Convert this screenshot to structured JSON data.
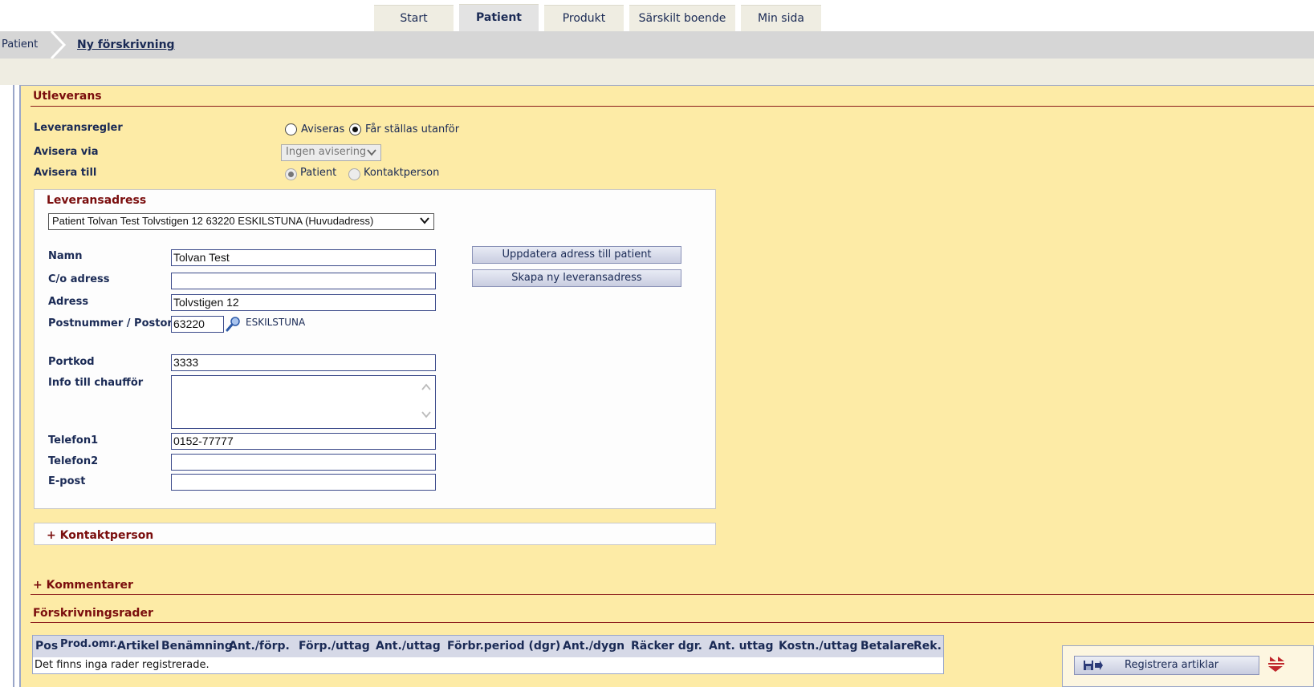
{
  "tabs": [
    {
      "label": "Start",
      "active": false
    },
    {
      "label": "Patient",
      "active": true
    },
    {
      "label": "Produkt",
      "active": false
    },
    {
      "label": "Särskilt boende",
      "active": false
    },
    {
      "label": "Min sida",
      "active": false
    }
  ],
  "breadcrumb": {
    "first": "Patient",
    "current": "Ny förskrivning"
  },
  "utleverans": {
    "title": "Utleverans",
    "leveransregler_label": "Leveransregler",
    "leveransregler_options": [
      "Aviseras",
      "Får ställas utanför"
    ],
    "leveransregler_selected": "Får ställas utanför",
    "avisera_via_label": "Avisera via",
    "avisera_via_value": "Ingen avisering",
    "avisera_till_label": "Avisera till",
    "avisera_till_options": [
      "Patient",
      "Kontaktperson"
    ],
    "avisera_till_selected": "Patient"
  },
  "leveransadress": {
    "title": "Leveransadress",
    "selected_address": "Patient Tolvan Test Tolvstigen 12 63220 ESKILSTUNA (Huvudadress)",
    "fields": {
      "namn_label": "Namn",
      "namn_value": "Tolvan Test",
      "co_label": "C/o adress",
      "co_value": "",
      "adress_label": "Adress",
      "adress_value": "Tolvstigen 12",
      "postnr_label": "Postnummer / Postort",
      "postnr_value": "63220",
      "postort": "ESKILSTUNA",
      "portkod_label": "Portkod",
      "portkod_value": "3333",
      "info_label": "Info till chaufför",
      "info_value": "",
      "tel1_label": "Telefon1",
      "tel1_value": "0152-77777",
      "tel2_label": "Telefon2",
      "tel2_value": "",
      "epost_label": "E-post",
      "epost_value": ""
    },
    "update_button": "Uppdatera adress till patient",
    "new_button": "Skapa ny leveransadress"
  },
  "kontaktperson": {
    "title": "+ Kontaktperson"
  },
  "kommentarer": {
    "title": "+ Kommentarer"
  },
  "forskrivningsrader": {
    "title": "Förskrivningsrader",
    "columns": [
      "Pos",
      "Prod.omr.",
      "Artikel",
      "Benämning",
      "Ant./förp.",
      "Förp./uttag",
      "Ant./uttag",
      "Förbr.period (dgr)",
      "Ant./dygn",
      "Räcker dgr.",
      "Ant. uttag",
      "Kostn./uttag",
      "Betalare",
      "Rek."
    ],
    "empty_text": "Det finns inga rader registrerade."
  },
  "register_button": "Registrera artiklar",
  "colors": {
    "panel": "#fdeba6",
    "section_title": "#7a0d0d",
    "text": "#1a2a55"
  }
}
